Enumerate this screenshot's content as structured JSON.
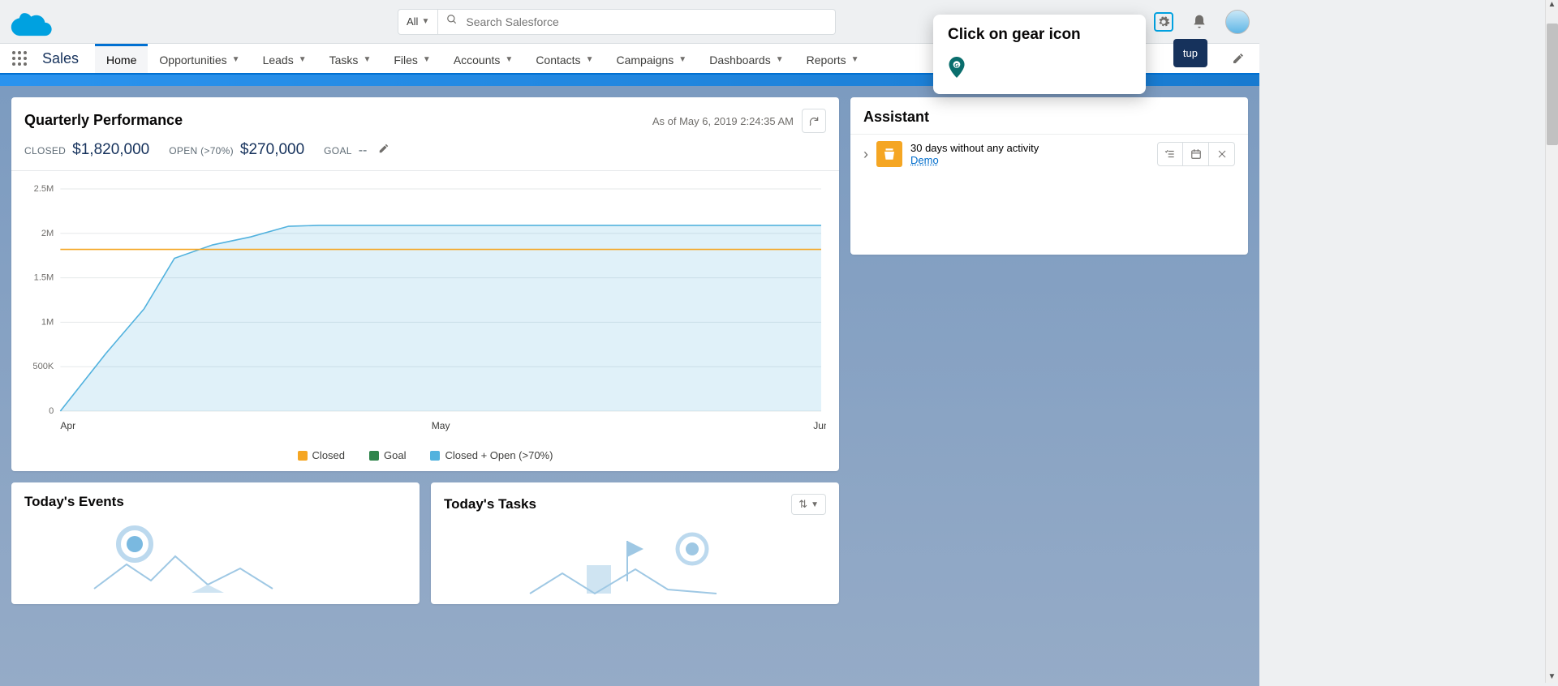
{
  "header": {
    "search_scope": "All",
    "search_placeholder": "Search Salesforce"
  },
  "tooltip": {
    "title": "Click on gear icon"
  },
  "setup_peek": "tup",
  "nav": {
    "app_name": "Sales",
    "items": [
      "Home",
      "Opportunities",
      "Leads",
      "Tasks",
      "Files",
      "Accounts",
      "Contacts",
      "Campaigns",
      "Dashboards",
      "Reports"
    ],
    "active_index": 0
  },
  "quarterly": {
    "title": "Quarterly Performance",
    "as_of": "As of May 6, 2019 2:24:35 AM",
    "closed_label": "CLOSED",
    "closed_value": "$1,820,000",
    "open_label": "OPEN (>70%)",
    "open_value": "$270,000",
    "goal_label": "GOAL",
    "goal_value": "--"
  },
  "chart_data": {
    "type": "area",
    "x": [
      "Apr",
      "May",
      "Jun"
    ],
    "ylim": [
      0,
      2500000
    ],
    "yticks": [
      {
        "v": 0,
        "l": "0"
      },
      {
        "v": 500000,
        "l": "500K"
      },
      {
        "v": 1000000,
        "l": "1M"
      },
      {
        "v": 1500000,
        "l": "1.5M"
      },
      {
        "v": 2000000,
        "l": "2M"
      },
      {
        "v": 2500000,
        "l": "2.5M"
      }
    ],
    "series": {
      "closed_plus_open": {
        "points": [
          [
            0,
            0
          ],
          [
            0.12,
            650000
          ],
          [
            0.22,
            1150000
          ],
          [
            0.3,
            1720000
          ],
          [
            0.4,
            1870000
          ],
          [
            0.5,
            1960000
          ],
          [
            0.6,
            2080000
          ],
          [
            0.68,
            2090000
          ],
          [
            1.0,
            2090000
          ],
          [
            2.0,
            2090000
          ]
        ],
        "color": "#52b2de"
      },
      "closed_flat": {
        "value": 1820000,
        "color": "#f5a623"
      }
    },
    "legend": [
      "Closed",
      "Goal",
      "Closed + Open (>70%)"
    ],
    "legend_colors": [
      "#f5a623",
      "#2e844a",
      "#52b2de"
    ]
  },
  "events": {
    "title": "Today's Events"
  },
  "tasks": {
    "title": "Today's Tasks"
  },
  "assistant": {
    "title": "Assistant",
    "item": {
      "headline": "30 days without any activity",
      "link": "Demo"
    }
  }
}
